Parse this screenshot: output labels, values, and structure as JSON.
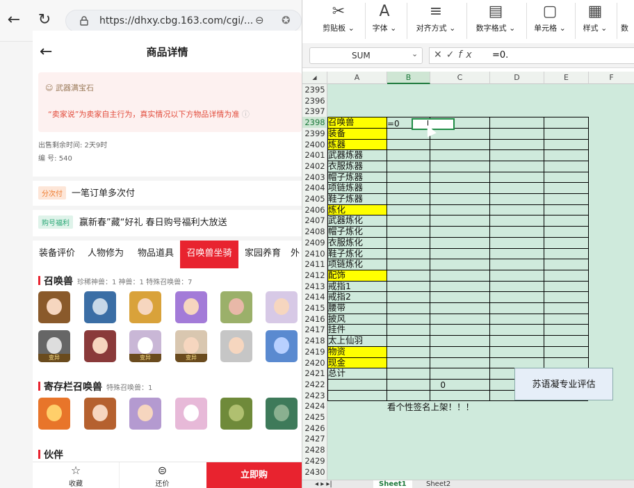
{
  "browser": {
    "url": "https://dhxy.cbg.163.com/cgi/..."
  },
  "page": {
    "title": "商品详情",
    "notice_tag": "武器满宝石",
    "notice_text": "“卖家说”为卖家自主行为，真实情况以下方物品详情为准",
    "time_left": "出售剩余时间: 2天9时",
    "serial": "编 号: 540",
    "installment_tag": "分次付",
    "installment_text": "一笔订单多次付",
    "promo_tag": "购号福利",
    "promo_text": "赢新春”藏“好礼 春日购号福利大放送",
    "tabs": [
      "装备评价",
      "人物修为",
      "物品道具",
      "召唤兽坐骑",
      "家园养育",
      "外"
    ],
    "pets_title": "召唤兽",
    "pets_sub": "珍稀神兽：1   神兽：1   特殊召唤兽：7",
    "storage_title": "寄存栏召唤兽",
    "storage_sub": "特殊召唤兽：1",
    "partner_title": "伙伴",
    "variant_label": "变异",
    "bottom": {
      "favorite": "收藏",
      "bargain": "还价",
      "buy": "立即购"
    }
  },
  "excel": {
    "ribbon": [
      "剪贴板",
      "字体",
      "对齐方式",
      "数字格式",
      "单元格",
      "样式",
      "数"
    ],
    "name_box": "SUM",
    "formula": "=0.",
    "columns": [
      "A",
      "B",
      "C",
      "D",
      "E",
      "F"
    ],
    "first_row": 2395,
    "rows_a": {
      "2398": "召唤兽",
      "2399": "装备",
      "2400": "炼器",
      "2401": "武器炼器",
      "2402": "衣服炼器",
      "2403": "帽子炼器",
      "2404": "项链炼器",
      "2405": "鞋子炼器",
      "2406": "炼化",
      "2407": "武器炼化",
      "2408": "帽子炼化",
      "2409": "衣服炼化",
      "2410": "鞋子炼化",
      "2411": "项链炼化",
      "2412": "配饰",
      "2413": "戒指1",
      "2414": "戒指2",
      "2415": "腰带",
      "2416": "披风",
      "2417": "挂件",
      "2418": "太上仙羽",
      "2419": "物资",
      "2420": "现金",
      "2421": "总计"
    },
    "yellow_rows": [
      2398,
      2399,
      2400,
      2406,
      2412,
      2419,
      2420
    ],
    "b2398": "=0",
    "total": "0",
    "slogan": "看个性签名上架！！！",
    "eval_box": "苏语凝专业评估",
    "sheets": [
      "Sheet1",
      "Sheet2"
    ]
  }
}
